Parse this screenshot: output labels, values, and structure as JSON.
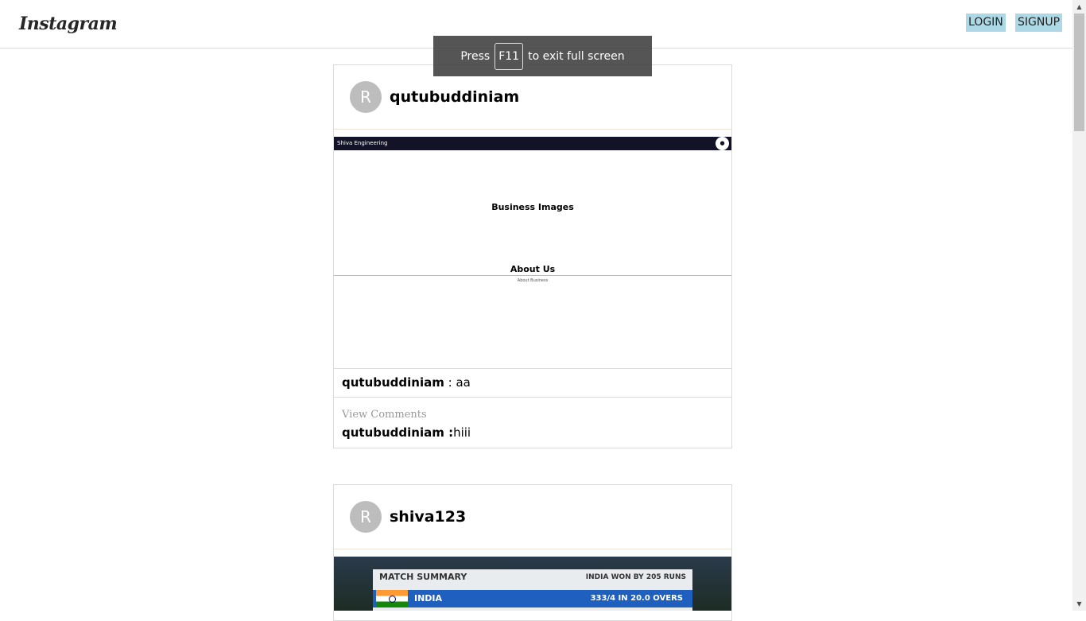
{
  "header": {
    "logo_text": "Instagram",
    "login_label": "LOGIN",
    "signup_label": "SIGNUP"
  },
  "fullscreen_toast": {
    "press_text": "Press",
    "key": "F11",
    "rest_text": "to exit full screen"
  },
  "posts": [
    {
      "avatar_letter": "R",
      "username": "qutubuddiniam",
      "image": {
        "brand": "Shiva Engineering",
        "hero": "Business Images",
        "about_heading": "About Us",
        "about_sub": "About Business"
      },
      "caption_user": "qutubuddiniam",
      "caption_text": " : aa",
      "view_comments": "View Comments",
      "comment_user": "qutubuddiniam :",
      "comment_text": "hiii"
    },
    {
      "avatar_letter": "R",
      "username": "shiva123",
      "image": {
        "title": "MATCH SUMMARY",
        "result": "INDIA WON BY 205 RUNS",
        "team": "INDIA",
        "score": "333/4 IN 20.0 OVERS"
      }
    }
  ],
  "icons": {
    "scroll_up": "triangle-up",
    "scroll_down": "triangle-down"
  }
}
